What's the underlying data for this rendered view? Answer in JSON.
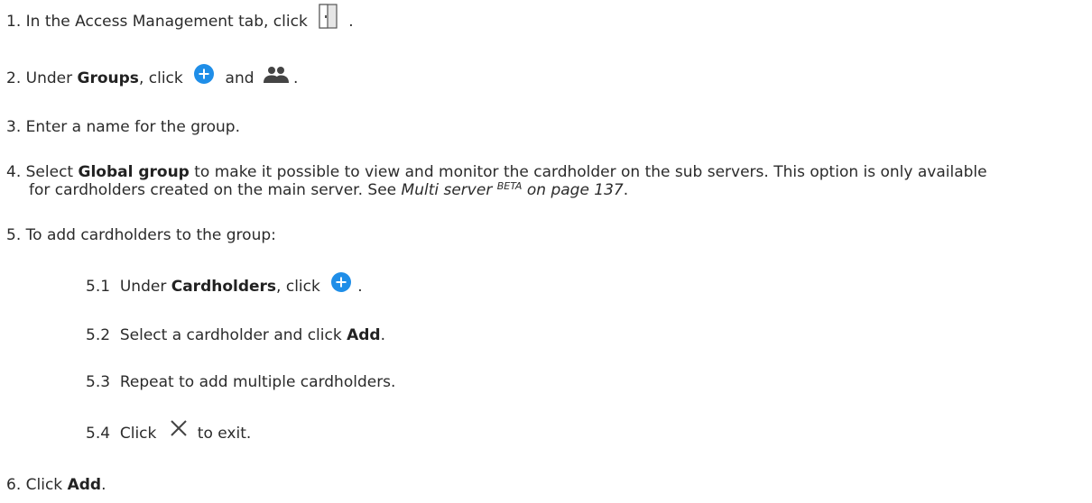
{
  "steps": {
    "s1": {
      "num": "1.",
      "text_before": "In the Access Management tab, click",
      "text_after": "."
    },
    "s2": {
      "num": "2.",
      "text_before": "Under",
      "bold_groups": "Groups",
      "text_mid": ", click",
      "text_and": "and",
      "text_after": "."
    },
    "s3": {
      "num": "3.",
      "text": "Enter a name for the group."
    },
    "s4": {
      "num": "4.",
      "text_before": "Select",
      "bold_global": "Global group",
      "text_line1_rest": "to make it possible to view and monitor the cardholder on the sub servers. This option is only available",
      "text_line2_before": "for cardholders created on the main server. See",
      "link_text": "Multi server",
      "link_sup": "BETA",
      "link_page": "on page 137",
      "text_line2_after": "."
    },
    "s5": {
      "num": "5.",
      "text": "To add cardholders to the group:"
    },
    "s5_1": {
      "num": "5.1",
      "text_before": "Under",
      "bold_cardholders": "Cardholders",
      "text_mid": ", click",
      "text_after": "."
    },
    "s5_2": {
      "num": "5.2",
      "text_before": "Select a cardholder and click",
      "bold_add": "Add",
      "text_after": "."
    },
    "s5_3": {
      "num": "5.3",
      "text": "Repeat to add multiple cardholders."
    },
    "s5_4": {
      "num": "5.4",
      "text_before": "Click",
      "text_after": "to exit."
    },
    "s6": {
      "num": "6.",
      "text_before": "Click",
      "bold_add": "Add",
      "text_after": "."
    }
  },
  "icons": {
    "door": "door-icon",
    "plus": "plus-circle-icon",
    "people": "people-icon",
    "close": "close-icon"
  },
  "colors": {
    "plus_blue": "#1f8ee8",
    "icon_dark": "#444444",
    "door_fill": "#d9d9d9"
  }
}
